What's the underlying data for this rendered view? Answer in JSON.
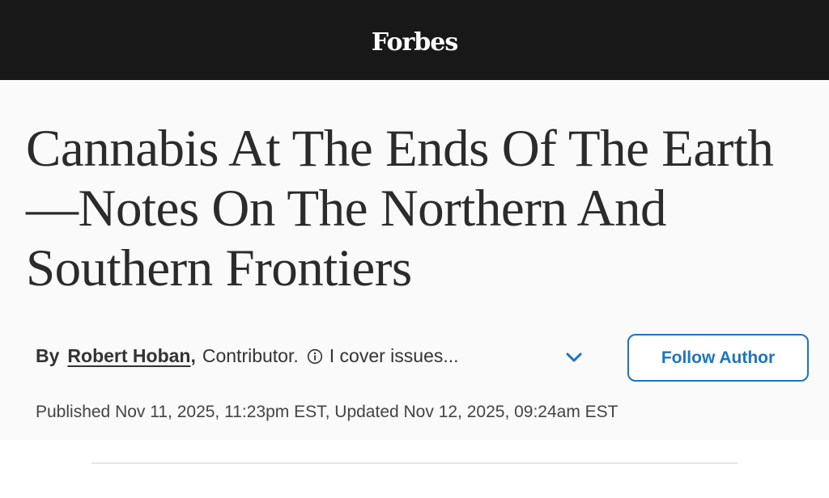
{
  "header": {
    "logo_text": "Forbes",
    "background": "#181818"
  },
  "article": {
    "headline": "Cannabis At The Ends Of The Earth—Notes On The Northern And Southern Frontiers",
    "byline": {
      "by_label": "By",
      "author": "Robert Hoban",
      "comma": ",",
      "role": "Contributor.",
      "info_icon": "info-circle-icon",
      "bio_snippet": "I cover issues...",
      "expand_icon": "chevron-down-icon"
    },
    "follow_button_label": "Follow Author",
    "dates": "Published Nov 11, 2025, 11:23pm EST, Updated Nov 12, 2025, 09:24am EST"
  },
  "colors": {
    "accent": "#1a74c7",
    "headline": "#2b2b2b"
  }
}
